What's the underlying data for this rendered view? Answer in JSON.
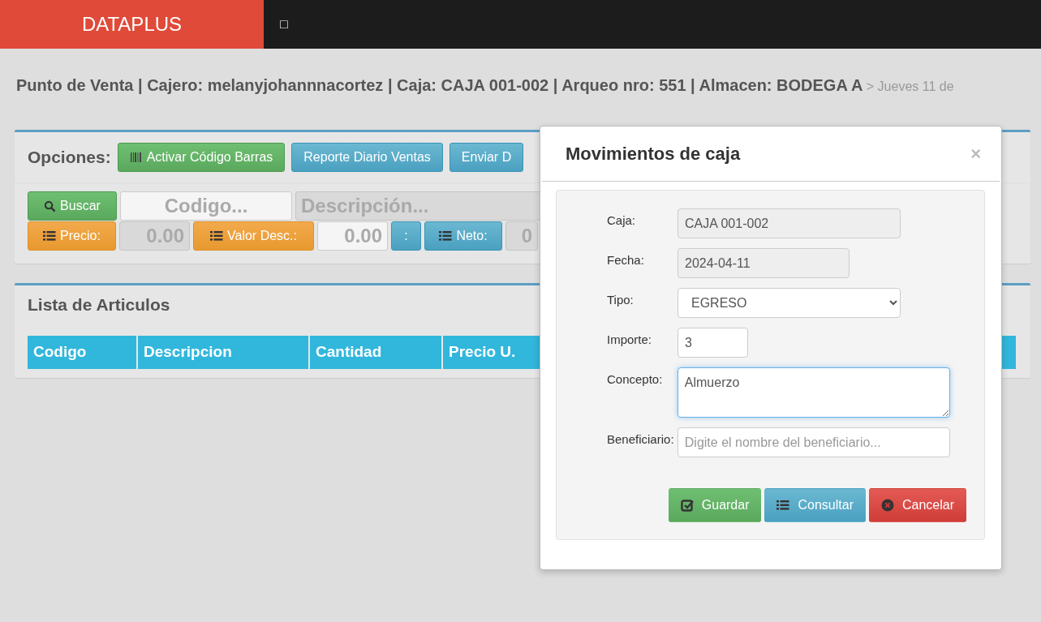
{
  "navbar": {
    "brand": "DATAPLUS",
    "toggle": "□"
  },
  "header": {
    "title": "Punto de Venta | Cajero: melanyjohannnacortez | Caja: CAJA 001-002 | Arqueo nro: 551 | Almacen: BODEGA A",
    "date": "> Jueves 11 de"
  },
  "options": {
    "label": "Opciones:",
    "buttons": [
      "Activar Código Barras",
      "Reporte Diario Ventas",
      "Enviar D"
    ]
  },
  "search_row": [
    {
      "kind": "button",
      "label": "Buscar"
    },
    {
      "kind": "field",
      "placeholder": "Codigo...",
      "disabled": false
    },
    {
      "kind": "field",
      "placeholder": "Descripción...",
      "disabled": true
    }
  ],
  "totals_row": [
    {
      "kind": "button",
      "label": "Precio:"
    },
    {
      "kind": "field",
      "placeholder": "0.00",
      "disabled": true
    },
    {
      "kind": "button",
      "label": "Valor Desc.:"
    },
    {
      "kind": "field",
      "placeholder": "0.00",
      "disabled": false
    },
    {
      "kind": "button",
      "label": ":"
    },
    {
      "kind": "button",
      "label": "Neto:"
    },
    {
      "kind": "field",
      "placeholder": "0",
      "disabled": true
    }
  ],
  "articles": {
    "title": "Lista de Articulos",
    "columns": [
      "Codigo",
      "Descripcion",
      "Cantidad",
      "Precio U."
    ]
  },
  "modal": {
    "title": "Movimientos de caja",
    "close": "×",
    "fields": [
      {
        "label": "Caja:",
        "kind": "input",
        "value": "CAJA 001-002",
        "disabled": true,
        "focused": false
      },
      {
        "label": "Fecha:",
        "kind": "input",
        "value": "2024-04-11",
        "disabled": true,
        "focused": false
      },
      {
        "label": "Tipo:",
        "kind": "select",
        "value": "EGRESO",
        "disabled": false,
        "focused": false
      },
      {
        "label": "Importe:",
        "kind": "input",
        "value": "3",
        "disabled": false,
        "focused": false
      },
      {
        "label": "Concepto:",
        "kind": "textarea",
        "value": "Almuerzo ",
        "disabled": false,
        "focused": true
      },
      {
        "label": "Beneficiario:",
        "kind": "input",
        "placeholder": "Digite el nombre del beneficiario...",
        "disabled": false,
        "focused": false
      }
    ],
    "buttons": [
      "Guardar",
      "Consultar",
      "Cancelar"
    ]
  }
}
